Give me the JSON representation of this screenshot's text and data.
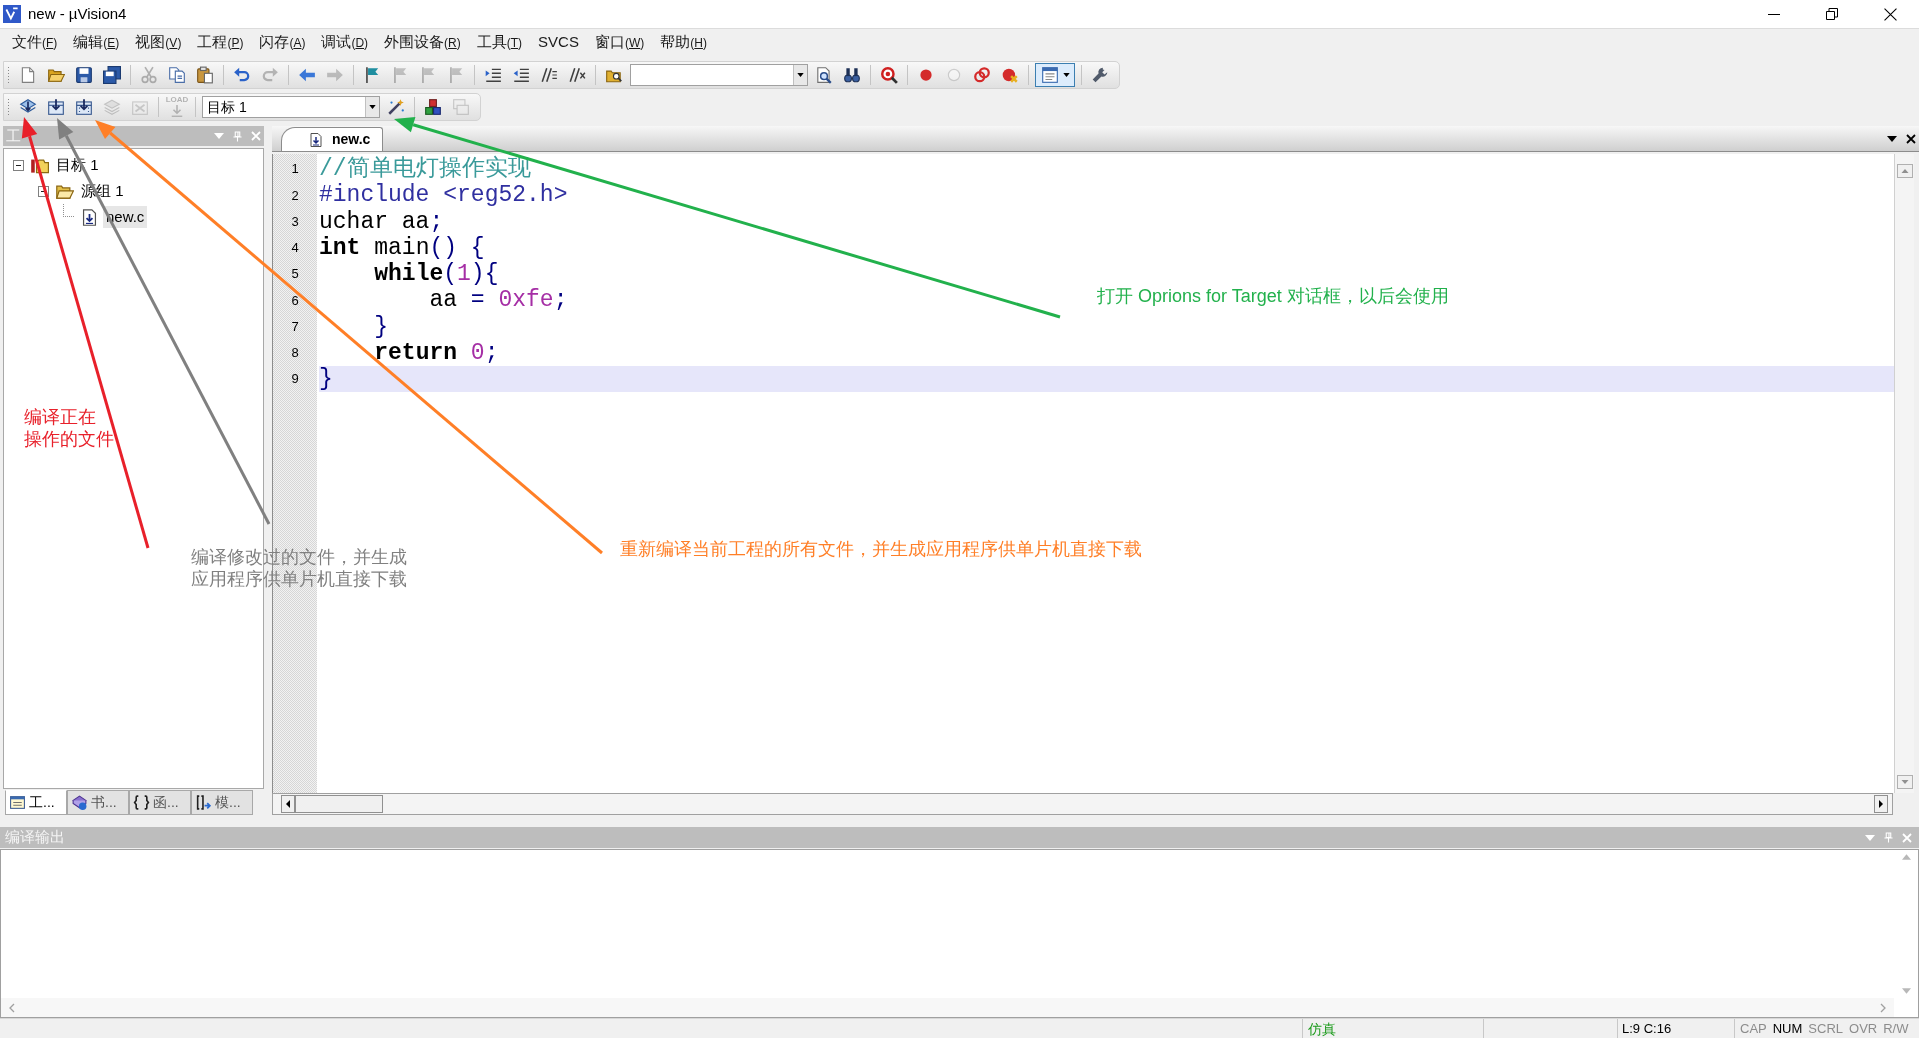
{
  "window": {
    "title": "new - µVision4"
  },
  "menu": [
    {
      "label": "文件",
      "accel": "(F)"
    },
    {
      "label": "编辑",
      "accel": "(E)"
    },
    {
      "label": "视图",
      "accel": "(V)"
    },
    {
      "label": "工程",
      "accel": "(P)"
    },
    {
      "label": "闪存",
      "accel": "(A)"
    },
    {
      "label": "调试",
      "accel": "(D)"
    },
    {
      "label": "外围设备",
      "accel": "(R)"
    },
    {
      "label": "工具",
      "accel": "(T)"
    },
    {
      "label": "SVCS"
    },
    {
      "label": "窗口",
      "accel": "(W)"
    },
    {
      "label": "帮助",
      "accel": "(H)"
    }
  ],
  "toolbars": [
    {
      "groups": [
        [
          {
            "kind": "new",
            "disabled": false
          },
          {
            "kind": "open",
            "disabled": false
          },
          {
            "kind": "save",
            "disabled": false
          },
          {
            "kind": "saveall",
            "disabled": false
          }
        ],
        [
          {
            "kind": "cut",
            "disabled": true
          },
          {
            "kind": "copy",
            "disabled": false
          },
          {
            "kind": "paste",
            "disabled": false
          }
        ],
        [
          {
            "kind": "undo",
            "disabled": false
          },
          {
            "kind": "redo",
            "disabled": true
          }
        ],
        [
          {
            "kind": "back",
            "disabled": false
          },
          {
            "kind": "forward",
            "disabled": true
          }
        ],
        [
          {
            "kind": "flag",
            "disabled": false
          },
          {
            "kind": "flag",
            "disabled": true
          },
          {
            "kind": "flag",
            "disabled": true
          },
          {
            "kind": "flag",
            "disabled": true
          }
        ],
        [
          {
            "kind": "indent",
            "disabled": false
          },
          {
            "kind": "outdent",
            "disabled": false
          },
          {
            "kind": "comment",
            "disabled": false
          },
          {
            "kind": "uncomment",
            "disabled": false
          }
        ],
        [
          {
            "kind": "findfiles",
            "disabled": false
          },
          {
            "kind": "combo",
            "disabled": false
          },
          {
            "kind": "find",
            "disabled": false
          },
          {
            "kind": "binoculars",
            "disabled": false
          }
        ],
        [
          {
            "kind": "debug",
            "disabled": false
          }
        ],
        [
          {
            "kind": "breakpoint",
            "disabled": false
          },
          {
            "kind": "bptoggle",
            "disabled": true
          },
          {
            "kind": "bpdisable",
            "disabled": false
          },
          {
            "kind": "bpkill",
            "disabled": false
          }
        ],
        [
          {
            "kind": "layout",
            "disabled": false
          }
        ],
        [
          {
            "kind": "wrench",
            "disabled": false
          }
        ]
      ]
    },
    {
      "groups": [
        [
          {
            "kind": "translate",
            "disabled": false
          },
          {
            "kind": "build",
            "disabled": false
          },
          {
            "kind": "rebuild",
            "disabled": false
          },
          {
            "kind": "batch",
            "disabled": true
          },
          {
            "kind": "stop",
            "disabled": true
          }
        ],
        [
          {
            "kind": "load",
            "label": "LOAD",
            "disabled": true
          }
        ],
        [
          {
            "kind": "combo",
            "value": "目标 1",
            "disabled": false
          },
          {
            "kind": "options",
            "disabled": false
          }
        ],
        [
          {
            "kind": "manage",
            "disabled": false
          },
          {
            "kind": "windows",
            "disabled": true
          }
        ]
      ]
    }
  ],
  "project_panel": {
    "title": "工",
    "tree": [
      {
        "label": "目标 1",
        "kind": "target",
        "expanded": true,
        "selected": false,
        "children": [
          {
            "label": "源组 1",
            "kind": "group",
            "expanded": true,
            "selected": false,
            "children": [
              {
                "label": "new.c",
                "kind": "file",
                "selected": true
              }
            ]
          }
        ]
      }
    ],
    "tabs": [
      {
        "label": "工...",
        "kind": "project",
        "selected": true
      },
      {
        "label": "书...",
        "kind": "books",
        "selected": false
      },
      {
        "label": "函...",
        "kind": "functions",
        "selected": false
      },
      {
        "label": "模...",
        "kind": "templates",
        "selected": false
      }
    ]
  },
  "editor": {
    "tabs": [
      {
        "label": "new.c",
        "selected": true
      }
    ],
    "lines": [
      {
        "number": "1",
        "current": false,
        "tokens": [
          {
            "text": "//简单电灯操作实现",
            "kind": "comment"
          }
        ]
      },
      {
        "number": "2",
        "current": false,
        "tokens": [
          {
            "text": "#include <reg52.h>",
            "kind": "preproc"
          }
        ]
      },
      {
        "number": "3",
        "current": false,
        "tokens": [
          {
            "text": "uchar aa",
            "kind": "plain"
          },
          {
            "text": ";",
            "kind": "op"
          }
        ]
      },
      {
        "number": "4",
        "current": false,
        "tokens": [
          {
            "text": "int",
            "kind": "keyword"
          },
          {
            "text": " main",
            "kind": "plain"
          },
          {
            "text": "() {",
            "kind": "op"
          }
        ]
      },
      {
        "number": "5",
        "current": false,
        "tokens": [
          {
            "text": "    while",
            "kind": "keyword"
          },
          {
            "text": "(",
            "kind": "op"
          },
          {
            "text": "1",
            "kind": "number"
          },
          {
            "text": "){",
            "kind": "op"
          }
        ]
      },
      {
        "number": "6",
        "current": false,
        "tokens": [
          {
            "text": "        aa",
            "kind": "plain"
          },
          {
            "text": " = ",
            "kind": "op"
          },
          {
            "text": "0xfe",
            "kind": "number"
          },
          {
            "text": ";",
            "kind": "op"
          }
        ]
      },
      {
        "number": "7",
        "current": false,
        "tokens": [
          {
            "text": "    }",
            "kind": "op"
          }
        ]
      },
      {
        "number": "8",
        "current": false,
        "tokens": [
          {
            "text": "    return",
            "kind": "keyword"
          },
          {
            "text": " 0",
            "kind": "number"
          },
          {
            "text": ";",
            "kind": "op"
          }
        ]
      },
      {
        "number": "9",
        "current": true,
        "tokens": [
          {
            "text": "}",
            "kind": "op"
          }
        ]
      }
    ]
  },
  "output_panel": {
    "title": "编译输出"
  },
  "status_bar": {
    "mode": "仿真",
    "position": "L:9 C:16",
    "indicators": [
      {
        "label": "CAP",
        "on": false
      },
      {
        "label": "NUM",
        "on": true
      },
      {
        "label": "SCRL",
        "on": false
      },
      {
        "label": "OVR",
        "on": false
      },
      {
        "label": "R/W",
        "on": false
      }
    ]
  },
  "annotations": [
    {
      "lines": [
        "编译正在",
        "操作的文件"
      ],
      "color": "#e8202a"
    },
    {
      "lines": [
        "编译修改过的文件，并生成",
        "应用程序供单片机直接下载"
      ],
      "color": "#808080"
    },
    {
      "lines": [
        "重新编译当前工程的所有文件，并生成应用程序供单片机直接下载"
      ],
      "color": "#ff7f27"
    },
    {
      "lines": [
        "打开 Oprions for Target 对话框，以后会使用"
      ],
      "color": "#22b14c"
    }
  ]
}
